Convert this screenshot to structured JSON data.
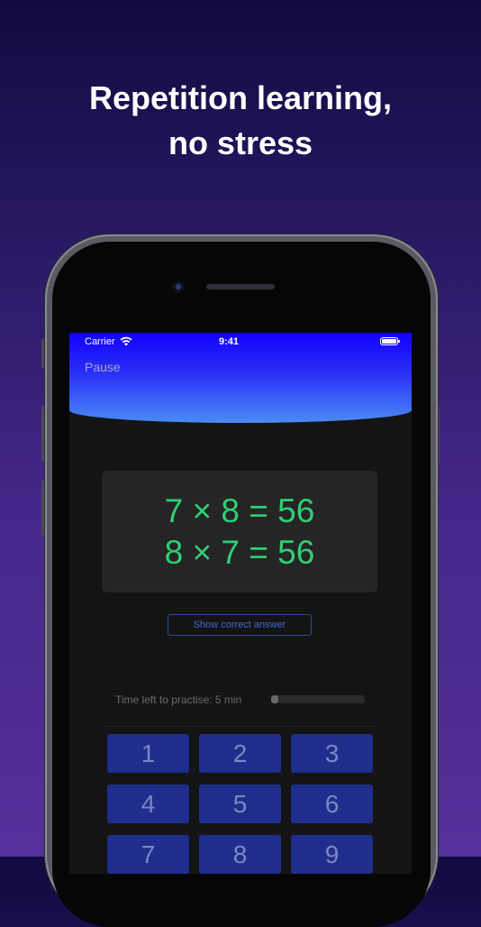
{
  "headline": {
    "line1": "Repetition learning,",
    "line2": "no stress"
  },
  "status_bar": {
    "carrier": "Carrier",
    "time": "9:41",
    "icons": [
      "wifi-icon",
      "battery-icon"
    ]
  },
  "header": {
    "pause_label": "Pause"
  },
  "question": {
    "line1": "7 × 8 = 56",
    "line2": "8 × 7 = 56"
  },
  "show_answer_label": "Show correct answer",
  "timer": {
    "label": "Time left to practise: 5 min",
    "progress": 0.08
  },
  "keypad": {
    "keys": [
      "1",
      "2",
      "3",
      "4",
      "5",
      "6",
      "7",
      "8",
      "9"
    ]
  },
  "colors": {
    "header_top": "#1400ff",
    "header_bottom": "#4a8cf4",
    "equation": "#2ecf75",
    "key_bg": "#1f2d8c",
    "key_text": "#7d86c2",
    "answer_button": "#3d6ad8",
    "screen_bg": "#141414"
  }
}
